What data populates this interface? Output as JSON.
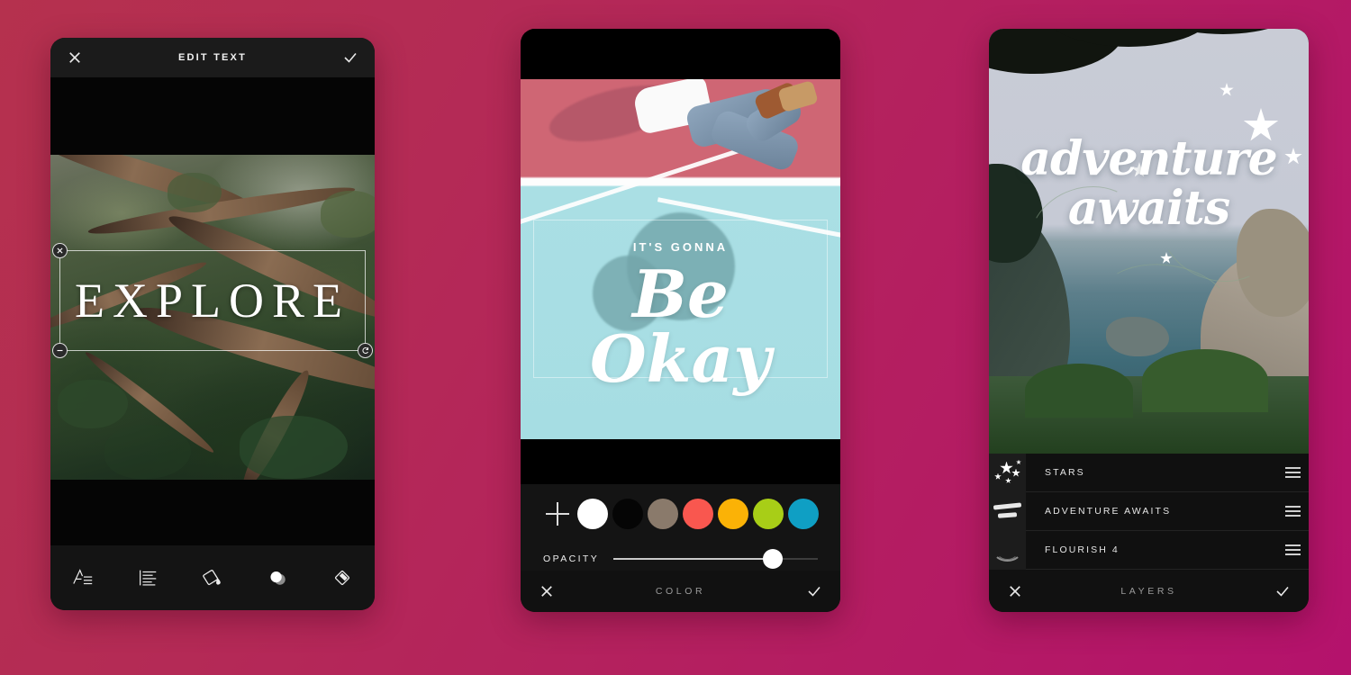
{
  "background": {
    "from": "#b5314e",
    "to": "#b4126c"
  },
  "phones": {
    "edit_text": {
      "header": {
        "title": "EDIT TEXT",
        "close_icon": "close-icon",
        "confirm_icon": "check-icon"
      },
      "canvas": {
        "text_layer": "EXPLORE",
        "photo_alt": "forest-branches-photo"
      },
      "toolbar": [
        {
          "name": "font-tool",
          "icon": "font-icon",
          "label": "Font"
        },
        {
          "name": "align-tool",
          "icon": "align-left-icon",
          "label": "Align"
        },
        {
          "name": "color-tool",
          "icon": "paint-bucket-icon",
          "label": "Color"
        },
        {
          "name": "opacity-tool",
          "icon": "opacity-circles-icon",
          "label": "Opacity"
        },
        {
          "name": "eraser-tool",
          "icon": "eraser-icon",
          "label": "Eraser"
        }
      ]
    },
    "color_editor": {
      "canvas": {
        "text_top": "IT'S GONNA",
        "text_script": "Be Okay",
        "photo_alt": "person-on-tennis-court-photo"
      },
      "add_color_label": "+",
      "swatches": [
        {
          "name": "white",
          "hex": "#ffffff"
        },
        {
          "name": "black",
          "hex": "#050505"
        },
        {
          "name": "taupe",
          "hex": "#8a7a6b"
        },
        {
          "name": "coral",
          "hex": "#f9574f"
        },
        {
          "name": "amber",
          "hex": "#fbb206"
        },
        {
          "name": "lime",
          "hex": "#a8ce17"
        },
        {
          "name": "teal",
          "hex": "#0f9fc4"
        }
      ],
      "opacity": {
        "label": "OPACITY",
        "value": 78
      },
      "footer": {
        "title": "COLOR",
        "close_icon": "close-icon",
        "confirm_icon": "check-icon"
      }
    },
    "layers_editor": {
      "canvas": {
        "text_line1": "adventure",
        "text_line2": "awaits",
        "photo_alt": "coastal-cliff-ocean-photo"
      },
      "layers": [
        {
          "name": "STARS",
          "thumb": "stars-thumbnail",
          "handle": "drag-handle-icon"
        },
        {
          "name": "ADVENTURE AWAITS",
          "thumb": "script-thumbnail",
          "handle": "drag-handle-icon"
        },
        {
          "name": "FLOURISH 4",
          "thumb": "flourish-thumbnail",
          "handle": "drag-handle-icon"
        }
      ],
      "footer": {
        "title": "LAYERS",
        "close_icon": "close-icon",
        "confirm_icon": "check-icon"
      }
    }
  }
}
